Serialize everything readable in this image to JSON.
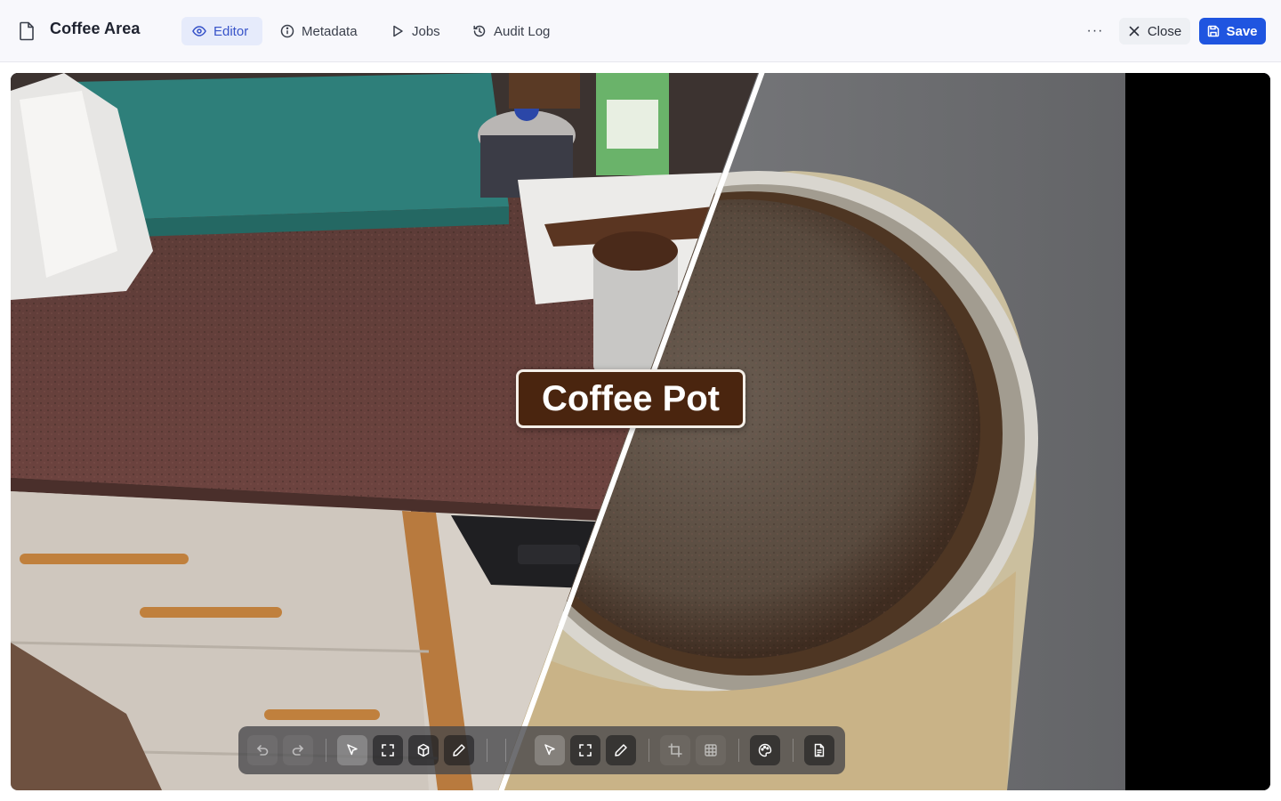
{
  "header": {
    "title": "Coffee Area",
    "tabs": [
      {
        "label": "Editor",
        "icon": "eye-icon",
        "active": true
      },
      {
        "label": "Metadata",
        "icon": "info-icon",
        "active": false
      },
      {
        "label": "Jobs",
        "icon": "play-icon",
        "active": false
      },
      {
        "label": "Audit Log",
        "icon": "history-icon",
        "active": false
      }
    ],
    "more_label": "···",
    "close_label": "Close",
    "save_label": "Save"
  },
  "canvas": {
    "overlay_label": "Coffee Pot"
  },
  "toolbar": {
    "groups": [
      [
        "undo-icon",
        "redo-icon"
      ],
      [
        "pointer-icon",
        "fit-screen-icon",
        "cube-icon",
        "pencil-icon"
      ],
      [
        "pointer-icon",
        "fit-screen-icon",
        "pencil-icon"
      ],
      [
        "crop-icon",
        "grid-icon"
      ],
      [
        "palette-icon"
      ],
      [
        "document-icon"
      ]
    ]
  },
  "colors": {
    "accent": "#1f55e0",
    "active_tab_bg": "#e6ebfb",
    "label_bg": "#4a250f"
  }
}
